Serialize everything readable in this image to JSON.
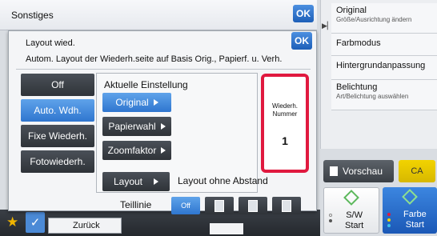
{
  "screen": {
    "title": "Sonstiges",
    "ok_label": "OK"
  },
  "right_panel": {
    "items": [
      {
        "title": "Original",
        "sub": "Größe/Ausrichtung ändern"
      },
      {
        "title": "Farbmodus",
        "sub": ""
      },
      {
        "title": "Hintergrundanpassung",
        "sub": ""
      },
      {
        "title": "Belichtung",
        "sub": "Art/Belichtung auswählen"
      }
    ]
  },
  "dialog": {
    "title": "Layout wied.",
    "subtitle": "Autom. Layout der Wiederh.seite auf Basis Orig., Papierf. u. Verh.",
    "ok_label": "OK",
    "modes": [
      "Off",
      "Auto. Wdh.",
      "Fixe Wiederh.",
      "Fotowiederh."
    ],
    "selected_mode": "Auto. Wdh.",
    "current_settings_title": "Aktuelle Einstellung",
    "setting_buttons": [
      "Original",
      "Papierwahl",
      "Zoomfaktor"
    ],
    "repeat_number_label": "Wiederh. Nummer",
    "repeat_number_value": "1",
    "layout_button": "Layout",
    "layout_value": "Layout ohne Abstand",
    "teillinie_label": "Teillinie",
    "teillinie_off": "Off"
  },
  "bottom": {
    "back_label": "Zurück",
    "preview_label": "Vorschau",
    "ca_label": "CA",
    "start_sw_line1": "S/W",
    "start_sw_line2": "Start",
    "start_color_line1": "Farbe",
    "start_color_line2": "Start"
  },
  "colors": {
    "accent_blue": "#2f76cf",
    "highlight_red": "#e0193f",
    "ca_yellow": "#e2c400"
  }
}
